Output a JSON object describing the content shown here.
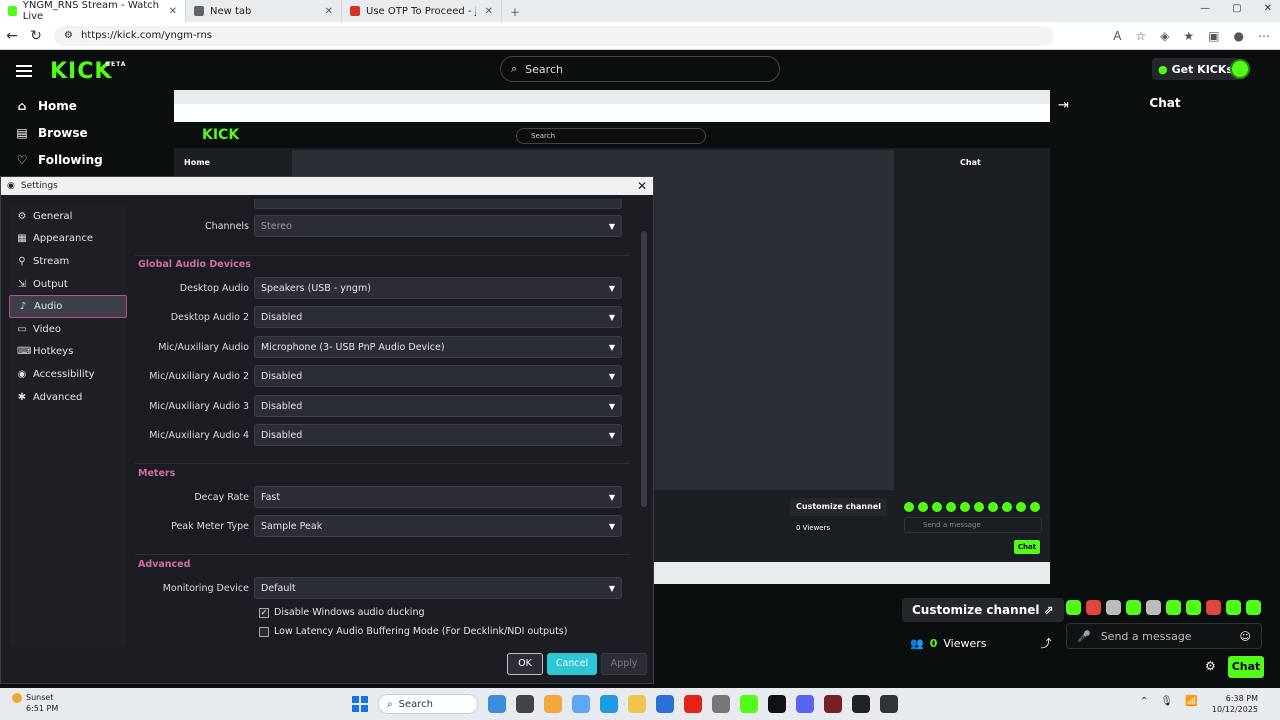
{
  "browser": {
    "tabs": [
      {
        "title": "YNGM_RNS Stream - Watch Live",
        "favicon_color": "#53fc18"
      },
      {
        "title": "New tab",
        "favicon_color": "#5f6368"
      },
      {
        "title": "Use OTP To Proceed - jose.quevedo",
        "favicon_color": "#d93025"
      }
    ],
    "url": "https://kick.com/yngm-rns"
  },
  "kick": {
    "logo": "KICK",
    "logo_badge": "BETA",
    "search_placeholder": "Search",
    "get_kicks": "Get KICKs",
    "nav": [
      {
        "label": "Home",
        "icon": "home-icon"
      },
      {
        "label": "Browse",
        "icon": "browse-icon"
      },
      {
        "label": "Following",
        "icon": "heart-icon"
      }
    ],
    "chat_title": "Chat",
    "customize_channel": "Customize channel",
    "viewers_count": "0",
    "viewers_label": "Viewers",
    "send_message_placeholder": "Send a message",
    "chat_button": "Chat",
    "inner": {
      "search": "Search",
      "home": "Home",
      "chat": "Chat",
      "customize": "Customize channel",
      "viewers": "0 Viewers",
      "send": "Send a message",
      "chat_btn": "Chat"
    }
  },
  "settings": {
    "title": "Settings",
    "nav": [
      {
        "label": "General",
        "icon": "gear-icon",
        "active": false
      },
      {
        "label": "Appearance",
        "icon": "palette-icon",
        "active": false
      },
      {
        "label": "Stream",
        "icon": "antenna-icon",
        "active": false
      },
      {
        "label": "Output",
        "icon": "output-icon",
        "active": false
      },
      {
        "label": "Audio",
        "icon": "speaker-icon",
        "active": true
      },
      {
        "label": "Video",
        "icon": "monitor-icon",
        "active": false
      },
      {
        "label": "Hotkeys",
        "icon": "keyboard-icon",
        "active": false
      },
      {
        "label": "Accessibility",
        "icon": "accessibility-icon",
        "active": false
      },
      {
        "label": "Advanced",
        "icon": "wrench-icon",
        "active": false
      }
    ],
    "channels_label": "Channels",
    "channels_value": "Stereo",
    "sections": {
      "global_audio": "Global Audio Devices",
      "meters": "Meters",
      "advanced": "Advanced"
    },
    "devices": [
      {
        "label": "Desktop Audio",
        "value": "Speakers (USB - yngm)"
      },
      {
        "label": "Desktop Audio 2",
        "value": "Disabled"
      },
      {
        "label": "Mic/Auxiliary Audio",
        "value": "Microphone (3- USB PnP Audio Device)"
      },
      {
        "label": "Mic/Auxiliary Audio 2",
        "value": "Disabled"
      },
      {
        "label": "Mic/Auxiliary Audio 3",
        "value": "Disabled"
      },
      {
        "label": "Mic/Auxiliary Audio 4",
        "value": "Disabled"
      }
    ],
    "meters": [
      {
        "label": "Decay Rate",
        "value": "Fast"
      },
      {
        "label": "Peak Meter Type",
        "value": "Sample Peak"
      }
    ],
    "monitoring_label": "Monitoring Device",
    "monitoring_value": "Default",
    "checkboxes": [
      {
        "label": "Disable Windows audio ducking",
        "checked": true
      },
      {
        "label": "Low Latency Audio Buffering Mode (For Decklink/NDI outputs)",
        "checked": false
      }
    ],
    "buttons": {
      "ok": "OK",
      "cancel": "Cancel",
      "apply": "Apply"
    }
  },
  "taskbar": {
    "weather_title": "Sunset",
    "weather_time": "6:51 PM",
    "search": "Search",
    "time": "6:38 PM",
    "date": "10/12/2025"
  }
}
